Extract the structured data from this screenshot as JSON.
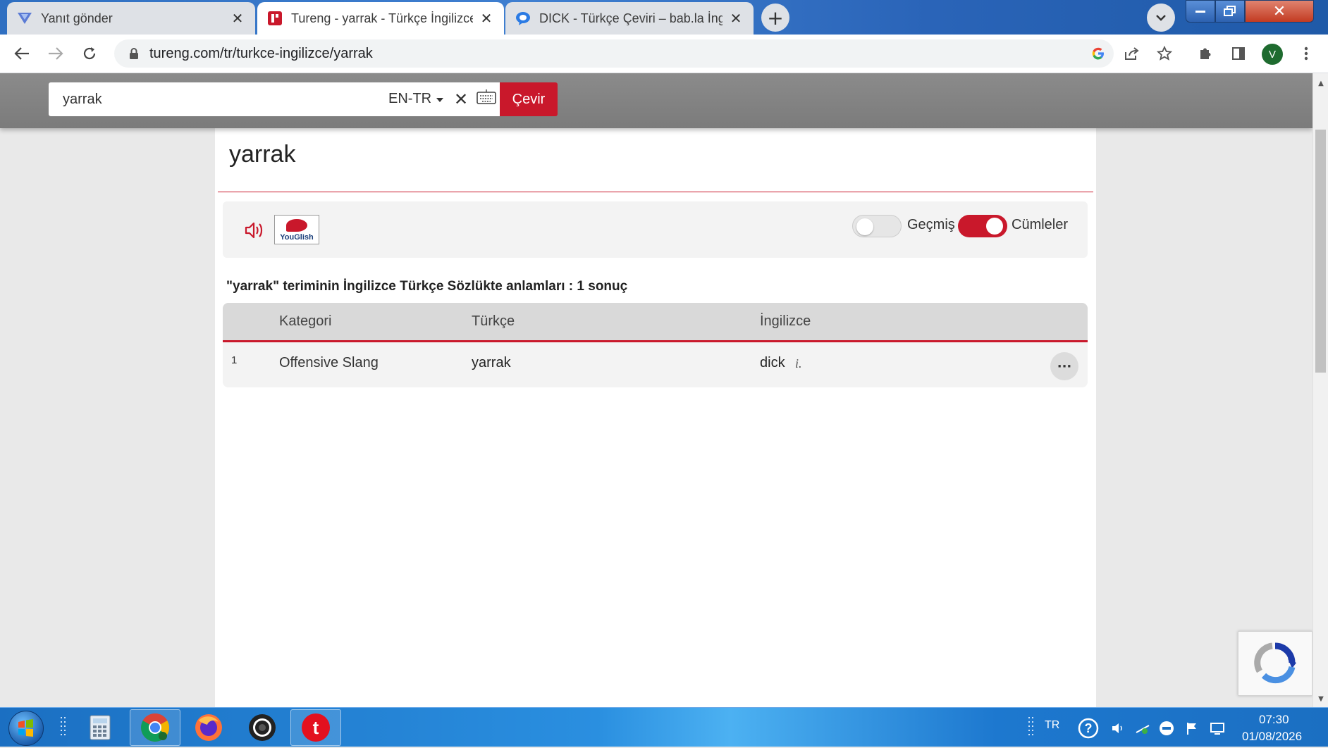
{
  "browser": {
    "tabs": [
      {
        "title": "Yanıt gönder",
        "active": false
      },
      {
        "title": "Tureng - yarrak - Türkçe İngilizce",
        "active": true
      },
      {
        "title": "DICK - Türkçe Çeviri – bab.la İngil",
        "active": false
      }
    ],
    "new_tab_label": "+",
    "url": "tureng.com/tr/turkce-ingilizce/yarrak",
    "profile_initial": "V"
  },
  "search": {
    "query": "yarrak",
    "language": "EN-TR",
    "clear_label": "✕",
    "translate_label": "Çevir"
  },
  "page": {
    "title": "yarrak",
    "toggles": [
      {
        "label": "Geçmiş",
        "on": false
      },
      {
        "label": "Cümleler",
        "on": true
      }
    ],
    "youglish_label": "YouGlish",
    "results_heading": "\"yarrak\" teriminin İngilizce Türkçe Sözlükte anlamları : 1 sonuç",
    "table": {
      "headers": [
        "Kategori",
        "Türkçe",
        "İngilizce"
      ],
      "rows": [
        {
          "num": "1",
          "category": "Offensive Slang",
          "turkish": "yarrak",
          "english": "dick",
          "note": "i."
        }
      ]
    },
    "more_label": "···"
  },
  "taskbar": {
    "lang": "TR",
    "time": "07:30",
    "date": "01/08/2026"
  },
  "colors": {
    "brand_red": "#c9182b",
    "header_gray": "#808080"
  }
}
